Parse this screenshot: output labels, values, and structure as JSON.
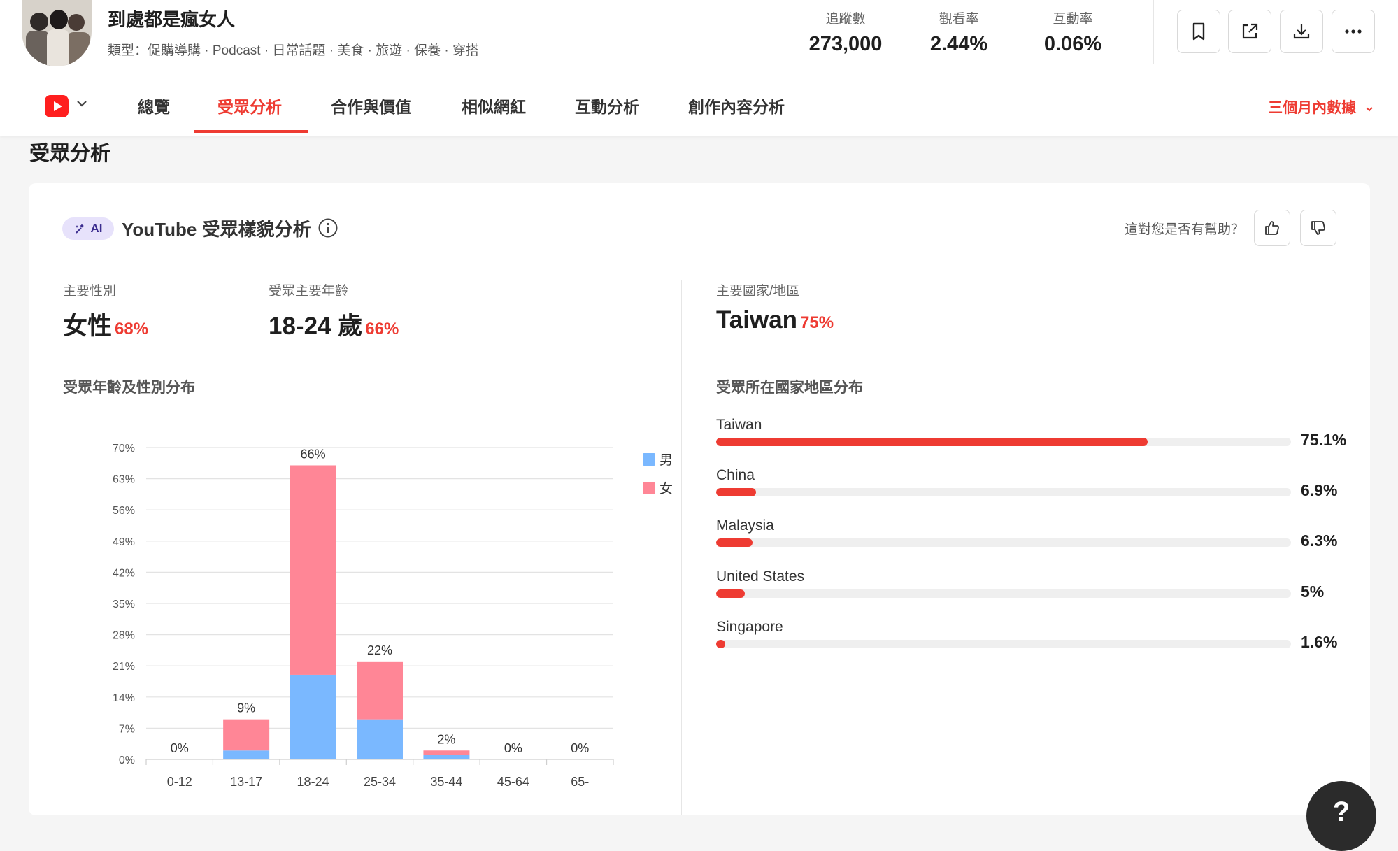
{
  "channel": {
    "name": "到處都是瘋女人",
    "type_line": "類型：促購導購 · Podcast · 日常話題 · 美食 · 旅遊 · 保養 · 穿搭"
  },
  "stats": [
    {
      "label": "追蹤數",
      "value": "273,000"
    },
    {
      "label": "觀看率",
      "value": "2.44%"
    },
    {
      "label": "互動率",
      "value": "0.06%"
    }
  ],
  "header_actions": [
    "bookmark-icon",
    "external-link-icon",
    "download-icon",
    "more-icon"
  ],
  "tabs": [
    {
      "label": "總覽"
    },
    {
      "label": "受眾分析",
      "active": true
    },
    {
      "label": "合作與價值"
    },
    {
      "label": "相似網紅"
    },
    {
      "label": "互動分析"
    },
    {
      "label": "創作內容分析"
    }
  ],
  "time_range": "三個月內數據",
  "section_title": "受眾分析",
  "card": {
    "ai_badge": "AI",
    "title": "YouTube 受眾樣貌分析",
    "helpful_prompt": "這對您是否有幫助？"
  },
  "kpis": {
    "gender": {
      "label": "主要性別",
      "value": "女性",
      "pct": "68%"
    },
    "age": {
      "label": "受眾主要年齡",
      "value": "18-24 歲",
      "pct": "66%"
    },
    "country": {
      "label": "主要國家/地區",
      "value": "Taiwan",
      "pct": "75%"
    }
  },
  "age_chart_title": "受眾年齡及性別分布",
  "country_chart_title": "受眾所在國家地區分布",
  "colors": {
    "accent": "#ee3b32",
    "male": "#7ab8ff",
    "female": "#ff8696"
  },
  "chart_data": [
    {
      "type": "bar",
      "stacked": true,
      "categories": [
        "0-12",
        "13-17",
        "18-24",
        "25-34",
        "35-44",
        "45-64",
        "65-"
      ],
      "series": [
        {
          "name": "男性",
          "values": [
            0,
            2,
            19,
            9,
            1,
            0,
            0
          ]
        },
        {
          "name": "女性",
          "values": [
            0,
            7,
            47,
            13,
            1,
            0,
            0
          ]
        }
      ],
      "total_labels": [
        "0%",
        "9%",
        "66%",
        "22%",
        "2%",
        "0%",
        "0%"
      ],
      "yticks": [
        "0%",
        "7%",
        "14%",
        "21%",
        "28%",
        "35%",
        "42%",
        "49%",
        "56%",
        "63%",
        "70%"
      ],
      "ylim": [
        0,
        70
      ],
      "legend": "top-right",
      "grid": true
    },
    {
      "type": "bar",
      "orientation": "horizontal",
      "categories": [
        "Taiwan",
        "China",
        "Malaysia",
        "United States",
        "Singapore"
      ],
      "values": [
        75.1,
        6.9,
        6.3,
        5,
        1.6
      ],
      "labels": [
        "75.1%",
        "6.9%",
        "6.3%",
        "5%",
        "1.6%"
      ]
    }
  ],
  "help_fab": "?"
}
